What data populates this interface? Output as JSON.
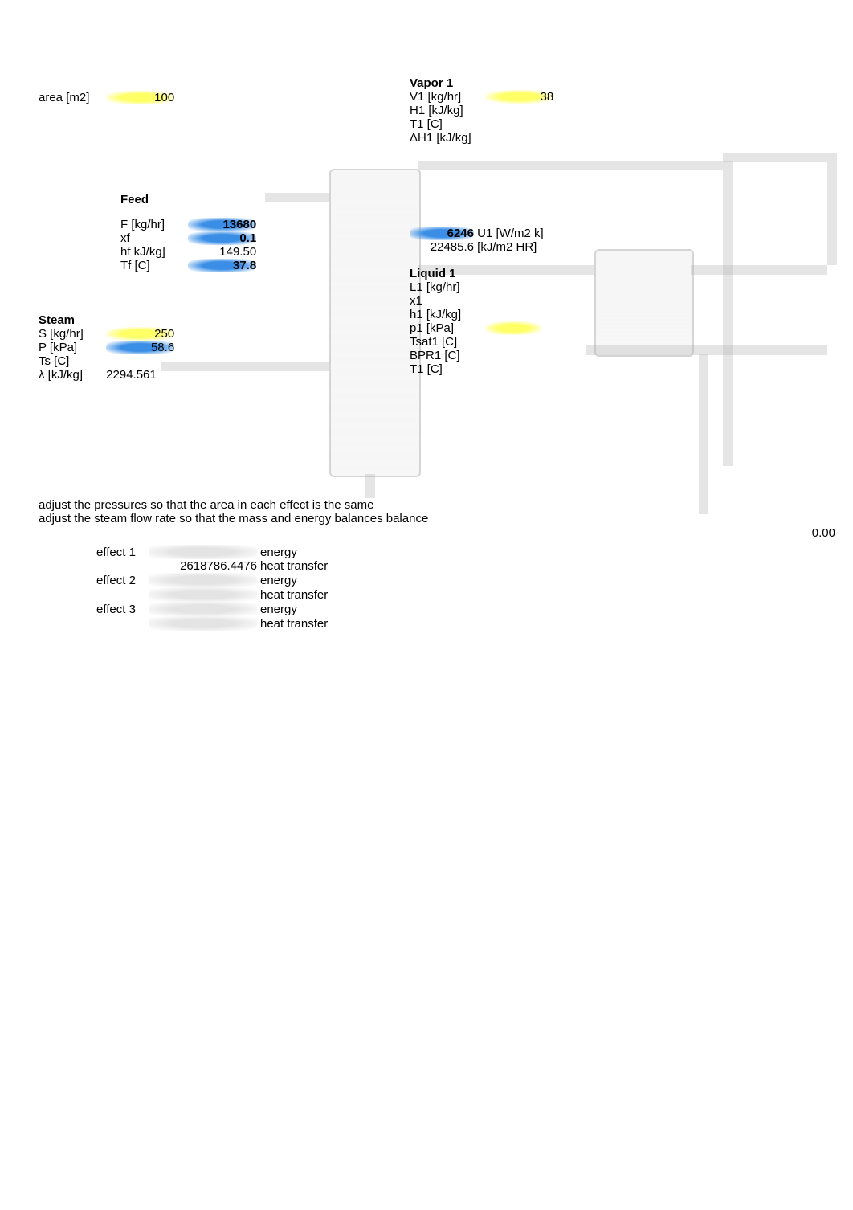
{
  "area": {
    "label": "area [m2]",
    "value": "100"
  },
  "vapor1": {
    "title": "Vapor 1",
    "v1_label": "V1 [kg/hr]",
    "v1_value": "38",
    "h1_label": "H1 [kJ/kg]",
    "t1_label": "T1 [C]",
    "dh1_label": "ΔH1 [kJ/kg]"
  },
  "feed": {
    "title": "Feed",
    "f_label": "F [kg/hr]",
    "f_value": "13680",
    "xf_label": "xf",
    "xf_value": "0.1",
    "hf_label": "hf kJ/kg]",
    "hf_value": "149.50",
    "tf_label": "Tf [C]",
    "tf_value": "37.8"
  },
  "steam": {
    "title": "Steam",
    "s_label": "S [kg/hr]",
    "s_value": "250",
    "p_label": "P [kPa]",
    "p_value": "58.6",
    "ts_label": "Ts [C]",
    "lambda_label": "λ  [kJ/kg]",
    "lambda_value": "2294.561"
  },
  "effect1_vals": {
    "u1_val": "6246",
    "u1_label": "U1 [W/m2 k]",
    "u1b_val": "22485.6",
    "u1b_label": "[kJ/m2 HR]"
  },
  "liquid1": {
    "title": "Liquid 1",
    "l1_label": "L1 [kg/hr]",
    "x1_label": "x1",
    "h1_label": "h1 [kJ/kg]",
    "p1_label": "p1 [kPa]",
    "tsat_label": "Tsat1 [C]",
    "bpr_label": "BPR1 [C]",
    "t1_label": "T1 [C]"
  },
  "instructions": {
    "line1": "adjust the pressures so that the area in each effect is the same",
    "line2": "adjust the steam flow rate so that the mass and energy balances balance"
  },
  "bottom_right": "0.00",
  "effects": {
    "e1_label": "effect 1",
    "e1_energy_label": "energy",
    "e1_ht_val": "2618786.4476",
    "e1_ht_label": "heat transfer",
    "e2_label": "effect 2",
    "e2_energy_label": "energy",
    "e2_ht_label": "heat transfer",
    "e3_label": "effect 3",
    "e3_energy_label": "energy",
    "e3_ht_label": "heat transfer"
  }
}
